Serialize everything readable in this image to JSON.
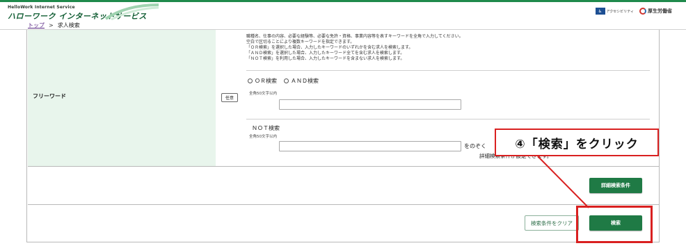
{
  "header": {
    "logo_sub": "HelloWork Internet Service",
    "logo_main": "ハローワーク インターネットサービス",
    "right_logo_1": "アクセシビリティ",
    "right_logo_2": "厚生労働省"
  },
  "breadcrumb": {
    "home": "トップ",
    "separator": ">",
    "current": "求人検索"
  },
  "free_word": {
    "label": "フリーワード",
    "optional_badge": "任意",
    "help_lines": [
      "職種名、仕事の内容、必要な経験等、必要な免許・資格、事業内容等を表すキーワードを全角で入力してください。",
      "空白で区切ることにより複数キーワードを指定できます。",
      "「ＯＲ検索」を選択した場合、入力したキーワードのいずれかを含む求人を検索します。",
      "「ＡＮＤ検索」を選択した場合、入力したキーワード全てを含む求人を検索します。",
      "「ＮＯＴ検索」を利用した場合、入力したキーワードを含まない求人を検索します。"
    ],
    "radio_or": "ＯＲ検索",
    "radio_and": "ＡＮＤ検索",
    "limit_hint": "全角50文字以内",
    "keyword_value": "",
    "not_title": "ＮＯＴ検索",
    "not_limit_hint": "全角50文字以内",
    "not_value": "",
    "exclude_suffix": "をのぞく"
  },
  "detail": {
    "status_text": "詳細検索条件が設定できます。",
    "button": "詳細検索条件"
  },
  "actions": {
    "clear_button": "検索条件をクリア",
    "search_button": "検索"
  },
  "annotation": {
    "callout": "④「検索」をクリック"
  },
  "colors": {
    "brand_green": "#1f7a45",
    "label_cell_bg": "#e8f5ec",
    "highlight_red": "#d92020"
  }
}
